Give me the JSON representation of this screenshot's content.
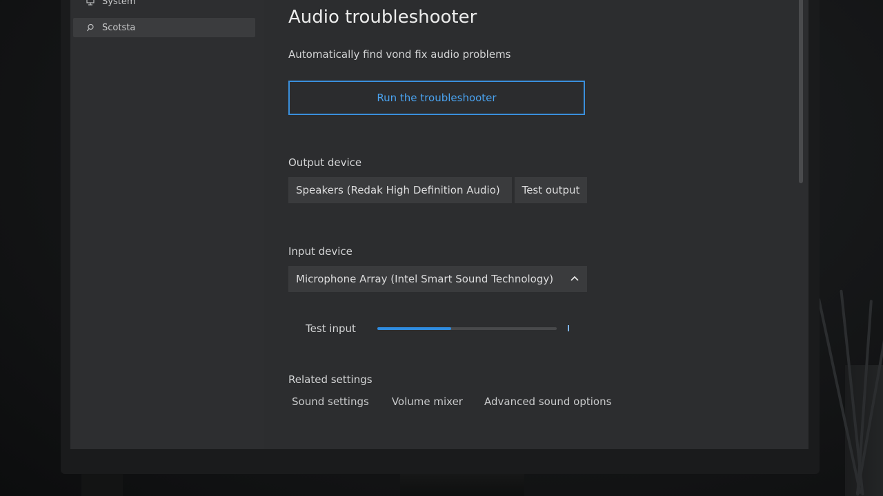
{
  "sidebar": {
    "items": [
      {
        "label": "System",
        "icon": "monitor-icon"
      },
      {
        "label": "Scotsta",
        "icon": "search-icon",
        "selected": true
      }
    ]
  },
  "main": {
    "title": "Audio troubleshooter",
    "subtitle": "Automatically find vond fix audio problems",
    "run_button": "Run the troubleshooter",
    "output": {
      "label": "Output device",
      "device": "Speakers (Redak High Definition Audio)",
      "test_button": "Test output"
    },
    "input": {
      "label": "Input device",
      "device": "Microphone Array (Intel Smart Sound Technology)",
      "test_label": "Test input",
      "level": 0.41
    },
    "related": {
      "label": "Related settings",
      "links": [
        "Sound settings",
        "Volume mixer",
        "Advanced sound options"
      ]
    }
  },
  "colors": {
    "accent": "#3a8fdc",
    "panel": "#2c2d2f",
    "control": "#3a3b3d"
  }
}
